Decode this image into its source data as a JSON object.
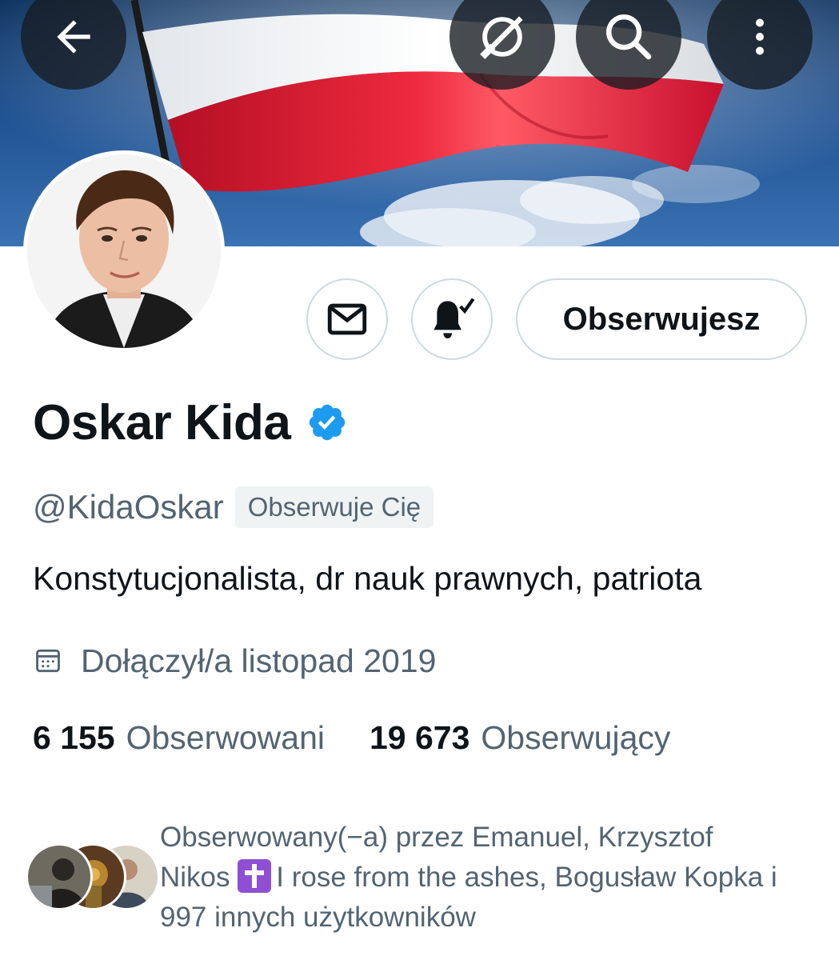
{
  "profile": {
    "display_name": "Oskar Kida",
    "handle": "@KidaOskar",
    "follows_you_badge": "Obserwuje Cię",
    "bio": "Konstytucjonalista, dr nauk prawnych, patriota",
    "joined": "Dołączył/a listopad 2019",
    "verified": true
  },
  "actions": {
    "follow_button_label": "Obserwujesz"
  },
  "stats": {
    "following_count": "6 155",
    "following_label": "Obserwowani",
    "followers_count": "19 673",
    "followers_label": "Obserwujący"
  },
  "followed_by": {
    "part1": "Obserwowany(−a) przez Emanuel, Krzysztof Nikos",
    "part2": "I rose from the ashes, Bogusław Kopka i 997 innych użytkowników"
  },
  "colors": {
    "verified_blue": "#1d9bf0",
    "secondary_text": "#536471",
    "primary_text": "#0f1419",
    "border": "#cfd9de",
    "flag_red": "#dc143c",
    "flag_white": "#f2f2f2"
  },
  "icons": {
    "back": "arrow-left-icon",
    "grok": "grok-icon",
    "search": "search-icon",
    "more": "more-vertical-icon",
    "message": "envelope-icon",
    "notifications": "bell-check-icon",
    "calendar": "calendar-icon",
    "verified": "verified-badge-icon",
    "emoji": "latin-cross-emoji"
  }
}
